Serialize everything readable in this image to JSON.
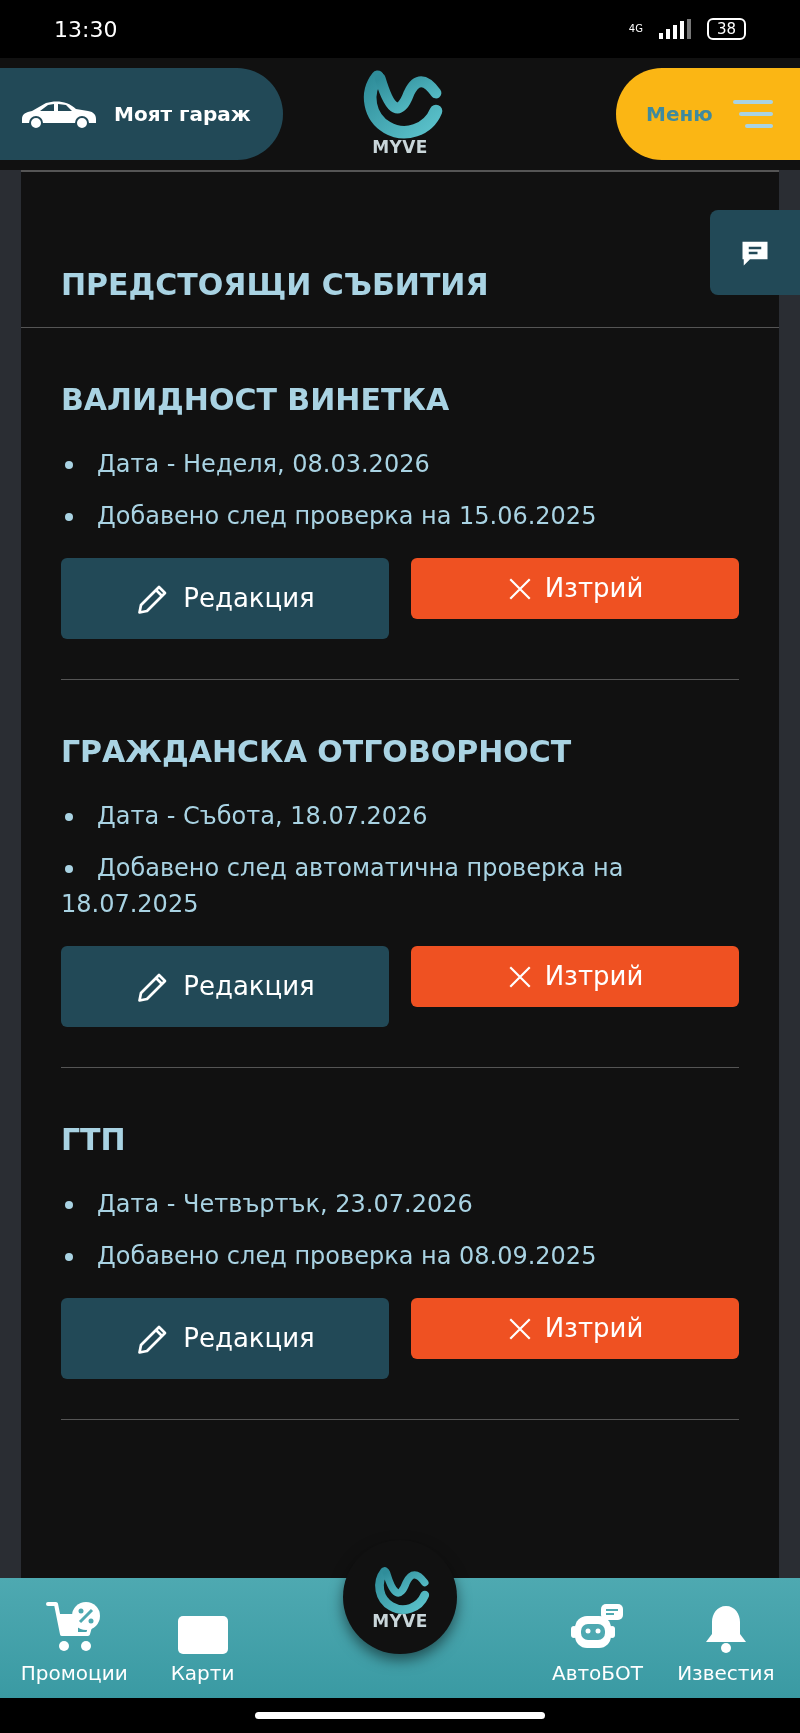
{
  "status_bar": {
    "time": "13:30",
    "network": "4G",
    "battery": "38"
  },
  "header": {
    "garage_button": "Моят гараж",
    "logo_text": "MYVE",
    "menu_button": "Меню"
  },
  "heading": "ПРЕДСТОЯЩИ СЪБИТИЯ",
  "events": [
    {
      "title": "ВАЛИДНОСТ ВИНЕТКА",
      "details": [
        "Дата - Неделя, 08.03.2026",
        "Добавено след проверка на 15.06.2025"
      ],
      "edit": "Редакция",
      "delete": "Изтрий"
    },
    {
      "title": "ГРАЖДАНСКА ОТГОВОРНОСТ",
      "details": [
        "Дата - Събота, 18.07.2026",
        "Добавено след автоматична проверка на 18.07.2025"
      ],
      "edit": "Редакция",
      "delete": "Изтрий"
    },
    {
      "title": "ГТП",
      "details": [
        "Дата - Четвъртък, 23.07.2026",
        "Добавено след проверка на 08.09.2025"
      ],
      "edit": "Редакция",
      "delete": "Изтрий"
    }
  ],
  "bottom_nav": {
    "items": [
      {
        "kind": "promo",
        "label": "Промоции"
      },
      {
        "kind": "cards",
        "label": "Карти"
      },
      {
        "kind": "bot",
        "label": "АвтоБОТ"
      },
      {
        "kind": "bell",
        "label": "Известия"
      }
    ],
    "logo_text": "MYVE"
  }
}
